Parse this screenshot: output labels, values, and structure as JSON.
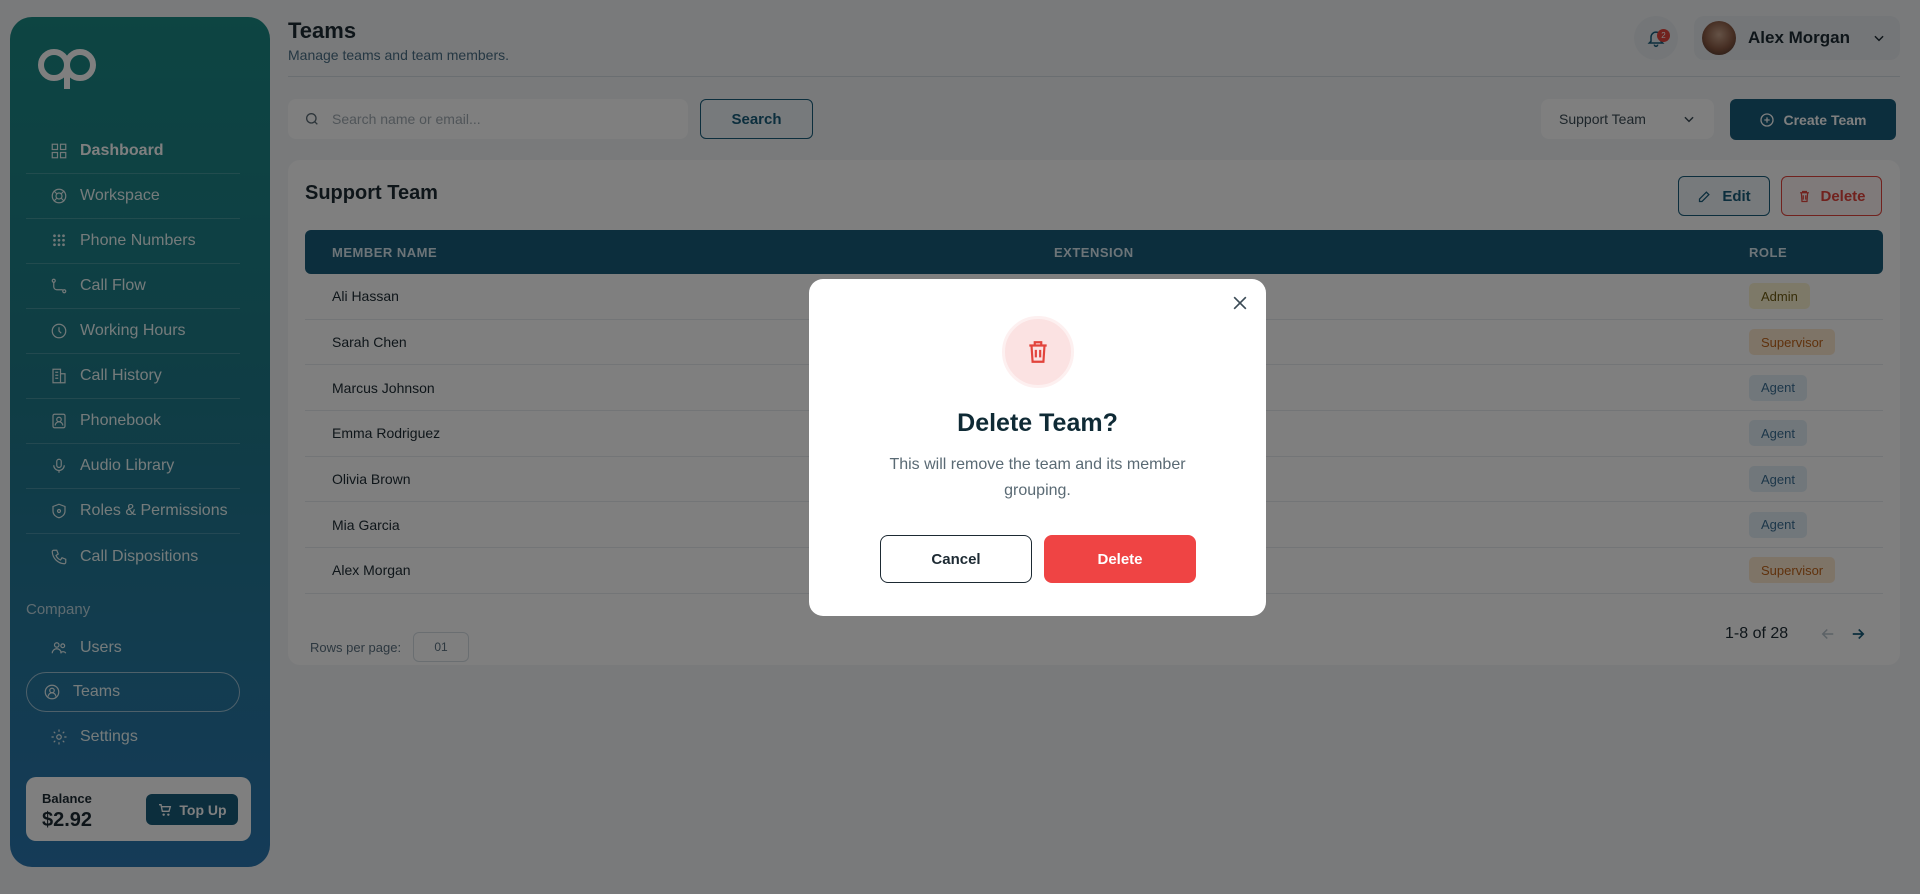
{
  "header": {
    "title": "Teams",
    "subtitle": "Manage teams and team members.",
    "notification_count": "2",
    "user_name": "Alex Morgan"
  },
  "sidebar": {
    "items": [
      {
        "label": "Dashboard",
        "icon": "grid-icon"
      },
      {
        "label": "Workspace",
        "icon": "lifebuoy-icon"
      },
      {
        "label": "Phone Numbers",
        "icon": "keypad-icon"
      },
      {
        "label": "Call Flow",
        "icon": "flow-icon"
      },
      {
        "label": "Working Hours",
        "icon": "clock-icon"
      },
      {
        "label": "Call History",
        "icon": "building-icon"
      },
      {
        "label": "Phonebook",
        "icon": "contact-book-icon"
      },
      {
        "label": "Audio Library",
        "icon": "microphone-icon"
      },
      {
        "label": "Roles & Permissions",
        "icon": "shield-icon"
      },
      {
        "label": "Call Dispositions",
        "icon": "phone-icon"
      }
    ],
    "section_label": "Company",
    "company_items": [
      {
        "label": "Users",
        "icon": "users-icon"
      },
      {
        "label": "Teams",
        "icon": "team-icon"
      },
      {
        "label": "Settings",
        "icon": "gear-icon"
      }
    ],
    "balance_label": "Balance",
    "balance_value": "$2.92",
    "topup_label": "Top Up"
  },
  "toolbar": {
    "search_placeholder": "Search name or email...",
    "search_label": "Search",
    "team_selected": "Support Team",
    "create_label": "Create Team"
  },
  "card": {
    "title": "Support Team",
    "edit_label": "Edit",
    "delete_label": "Delete",
    "columns": [
      "MEMBER NAME",
      "EXTENSION",
      "ROLE"
    ],
    "rows": [
      {
        "name": "Ali Hassan",
        "role": "Admin"
      },
      {
        "name": "Sarah Chen",
        "role": "Supervisor"
      },
      {
        "name": "Marcus Johnson",
        "role": "Agent"
      },
      {
        "name": "Emma Rodriguez",
        "role": "Agent"
      },
      {
        "name": "Olivia Brown",
        "role": "Agent"
      },
      {
        "name": "Mia Garcia",
        "role": "Agent"
      },
      {
        "name": "Alex Morgan",
        "role": "Supervisor"
      }
    ],
    "rows_per_page_label": "Rows per page:",
    "rows_per_page_value": "01",
    "page_info": "1-8 of 28"
  },
  "modal": {
    "title": "Delete Team?",
    "message": "This will remove the team and its member grouping.",
    "cancel_label": "Cancel",
    "confirm_label": "Delete"
  },
  "colors": {
    "primary": "#185c7a",
    "danger": "#ef4444",
    "sidebar_top": "#1a8a85",
    "sidebar_bottom": "#2a76b0"
  }
}
